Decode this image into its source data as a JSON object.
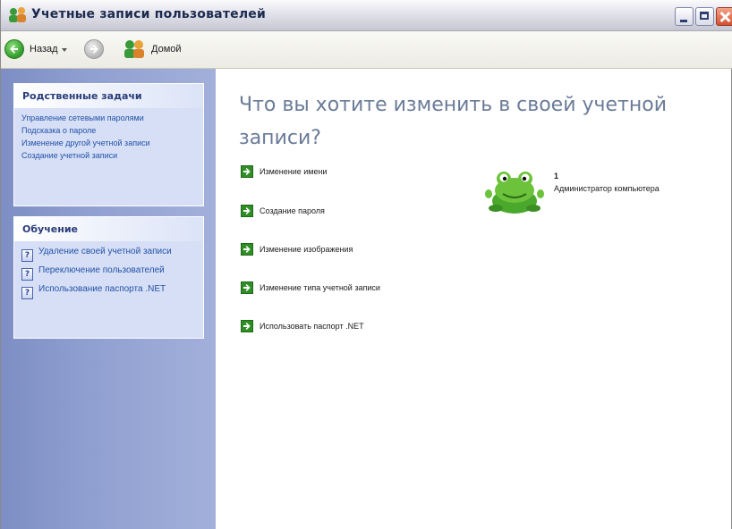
{
  "window": {
    "title": "Учетные записи пользователей"
  },
  "toolbar": {
    "back_label": "Назад",
    "home_label": "Домой"
  },
  "left_pane": {
    "related_tasks": {
      "heading": "Родственные задачи",
      "items": [
        "Управление сетевыми паролями",
        "Подсказка о пароле",
        "Изменение другой учетной записи",
        "Создание учетной записи"
      ]
    },
    "learn": {
      "heading": "Обучение",
      "items": [
        "Удаление своей учетной записи",
        "Переключение пользователей",
        "Использование паспорта .NET"
      ]
    }
  },
  "main": {
    "title": "Что вы хотите изменить в своей учетной записи?",
    "tasks": [
      "Изменение имени",
      "Создание пароля",
      "Изменение изображения",
      "Изменение типа учетной записи",
      "Использовать паспорт .NET"
    ],
    "account": {
      "name": "1",
      "type": "Администратор компьютера",
      "picture": "frog-icon"
    }
  },
  "colors": {
    "left_pane": "#8f9fd0",
    "panel_bg": "#d6dff5",
    "link": "#2452a8",
    "title_text": "#6a7b98",
    "task_arrow": "#2f8d26"
  }
}
